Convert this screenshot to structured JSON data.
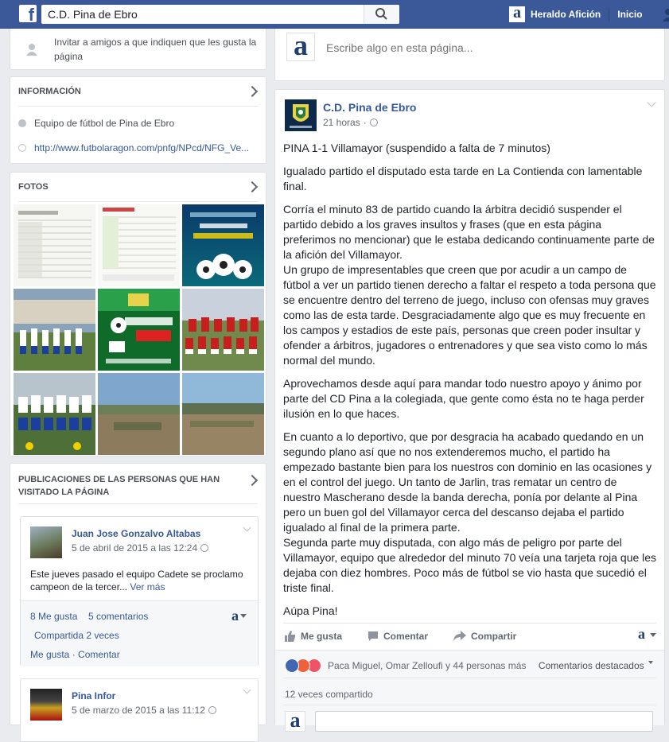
{
  "topbar": {
    "search_value": "C.D. Pina de Ebro",
    "user_name": "Heraldo Afición",
    "home_label": "Inicio",
    "brand_color": "#3b5998"
  },
  "invite": {
    "text": "Invitar a amigos a que indiquen que les gusta la página"
  },
  "info": {
    "heading": "INFORMACIÓN",
    "category": "Equipo de fútbol de Pina de Ebro",
    "website": "http://www.futbolaragon.com/pnfg/NPcd/NFG_Ve..."
  },
  "photos": {
    "heading": "FOTOS"
  },
  "visitor_posts": {
    "heading": "PUBLICACIONES DE LAS PERSONAS QUE HAN VISITADO LA PÁGINA",
    "post1": {
      "author": "Juan Jose Gonzalvo Altabas",
      "date": "5 de abril de 2015 a las 12:24",
      "text": "Este jueves pasado el equipo Cadete se proclamo campeon de la tercer...",
      "more": "Ver más",
      "likes": "8 Me gusta",
      "comments": "5 comentarios",
      "shares": "Compartida 2 veces",
      "like_action": "Me gusta",
      "comment_action": "Comentar"
    },
    "post2": {
      "author": "Pina Infor",
      "date": "5 de marzo de 2015 a las 11:12"
    }
  },
  "composer": {
    "placeholder": "Escribe algo en esta página..."
  },
  "post": {
    "page_name": "C.D. Pina de Ebro",
    "time": "21 horas",
    "p1": "PINA 1-1 Villamayor (suspendido a falta de 7 minutos)",
    "p2": "Igualado partido el disputado esta tarde en La Contienda con lamentable final.",
    "p3": "Corría el minuto 83 de partido cuando la árbitra decidió suspender el partido debido a los graves insultos y frases (que en esta página preferimos no mencionar) que le estaba dedicando continuamente parte de la afición del Villamayor.\nUn grupo de impresentables que creen que por acudir a un campo de fútbol a ver un partido tienen derecho a faltar el respeto a toda persona que se encuentre dentro del terreno de juego, incluso con ofensas muy graves como las de esta tarde. Desgraciadamente algo que es muy frecuente en los campos y estadios de este país, personas que creen poder insultar y ofender a árbitros, jugadores o entrenadores y que sea visto como lo más normal del mundo.",
    "p4": "Aprovechamos desde aquí para mandar todo nuestro apoyo y ánimo por parte del CD Pina a la colegiada, que gente como ésta no te haga perder ilusión en lo que haces.",
    "p5": "En cuanto a lo deportivo, que por desgracia ha acabado quedando en un segundo plano así que no nos extenderemos mucho, el partido ha empezado bastante bien para los nuestros con dominio en las ocasiones y en el control del juego. Un tanto de Jarlin, tras rematar un centro de nuestro Mascherano desde la banda derecha, ponía por delante al Pina pero un buen gol del Villamayor cerca del descanso dejaba el partido igualado al final de la primera parte.\nSegunda parte muy disputada, con algo más de peligro por parte del Villamayor, equipo que alrededor del minuto 70 veía una tarjeta roja que les dejaba con diez hombres. Poco más de fútbol se vio hasta que sucedió el triste final.",
    "p6": "Aúpa Pina!",
    "like": "Me gusta",
    "comment": "Comentar",
    "share": "Compartir",
    "reactions_text": "Paca Miguel, Omar Zelloufi y 44 personas más",
    "top_comments": "Comentarios destacados",
    "shared_count": "12 veces compartido"
  }
}
